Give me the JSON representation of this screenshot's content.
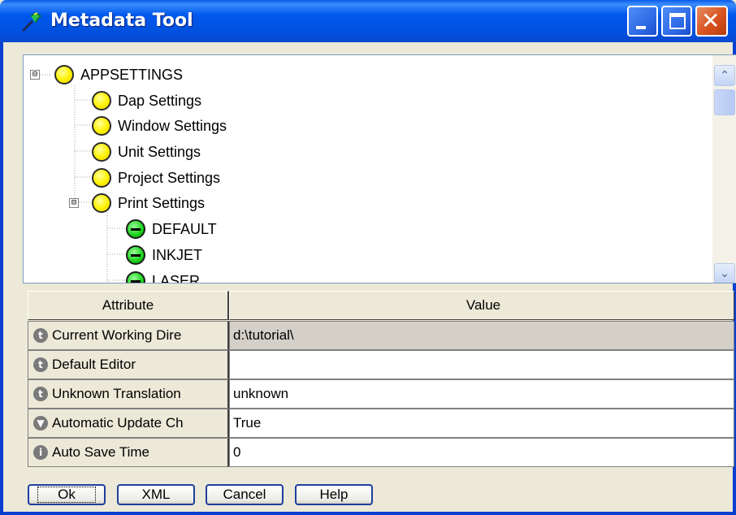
{
  "window": {
    "title": "Metadata Tool",
    "title_icon": "wand-icon",
    "controls": {
      "minimize": "minimize-icon",
      "maximize": "maximize-icon",
      "close": "close-icon"
    }
  },
  "tree": {
    "root": {
      "label": "APPSETTINGS",
      "expander": "⊟"
    },
    "children": [
      {
        "label": "Dap Settings"
      },
      {
        "label": "Window Settings"
      },
      {
        "label": "Unit Settings"
      },
      {
        "label": "Project Settings"
      },
      {
        "label": "Print Settings",
        "expander": "⊟"
      }
    ],
    "print_children": [
      {
        "label": "DEFAULT"
      },
      {
        "label": "INKJET"
      },
      {
        "label": "LASER"
      }
    ]
  },
  "grid": {
    "headers": {
      "attribute": "Attribute",
      "value": "Value"
    },
    "rows": [
      {
        "attribute": "Current Working Dire",
        "value": "d:\\tutorial\\",
        "icon": "t"
      },
      {
        "attribute": "Default Editor",
        "value": "",
        "icon": "t"
      },
      {
        "attribute": "Unknown Translation",
        "value": "unknown",
        "icon": "t"
      },
      {
        "attribute": "Automatic Update Ch",
        "value": "True",
        "icon": "▼"
      },
      {
        "attribute": "Auto Save Time",
        "value": "0",
        "icon": "i"
      }
    ]
  },
  "buttons": {
    "ok": "Ok",
    "xml": "XML",
    "cancel": "Cancel",
    "help": "Help"
  },
  "colors": {
    "titlebar": "#0054E3",
    "node_yellow": "#FFF200",
    "node_green": "#18D018",
    "selected_row": "#D4D0C8"
  }
}
